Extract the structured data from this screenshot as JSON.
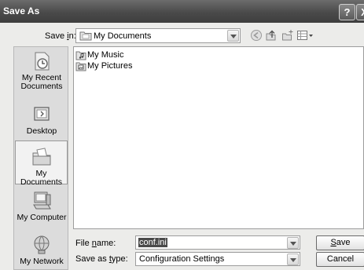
{
  "window": {
    "title": "Save As",
    "help_glyph": "?",
    "close_glyph": "X"
  },
  "save_in": {
    "label_pre": "Save ",
    "label_ul": "i",
    "label_post": "n:",
    "value": "My Documents"
  },
  "toolbar": {
    "icons": [
      "back-icon",
      "up-folder-icon",
      "new-folder-icon",
      "views-menu-icon"
    ]
  },
  "places": [
    {
      "label": "My Recent Documents",
      "icon": "recent-documents-icon"
    },
    {
      "label": "Desktop",
      "icon": "desktop-icon"
    },
    {
      "label": "My Documents",
      "icon": "my-documents-icon",
      "selected": true
    },
    {
      "label": "My Computer",
      "icon": "my-computer-icon"
    },
    {
      "label": "My Network",
      "icon": "my-network-icon"
    }
  ],
  "files": [
    {
      "name": "My Music",
      "icon": "music-folder-icon"
    },
    {
      "name": "My Pictures",
      "icon": "pictures-folder-icon"
    }
  ],
  "file_name": {
    "label_pre": "File ",
    "label_ul": "n",
    "label_post": "ame:",
    "value": "conf.ini"
  },
  "save_as_type": {
    "label_pre": "Save as ",
    "label_ul": "t",
    "label_post": "ype:",
    "value": "Configuration Settings"
  },
  "buttons": {
    "save_ul": "S",
    "save_rest": "ave",
    "cancel": "Cancel"
  },
  "colors": {
    "titlebar": "#4a4a4a",
    "selection": "#4a4a4a",
    "places_bg": "#dcdcdc"
  }
}
